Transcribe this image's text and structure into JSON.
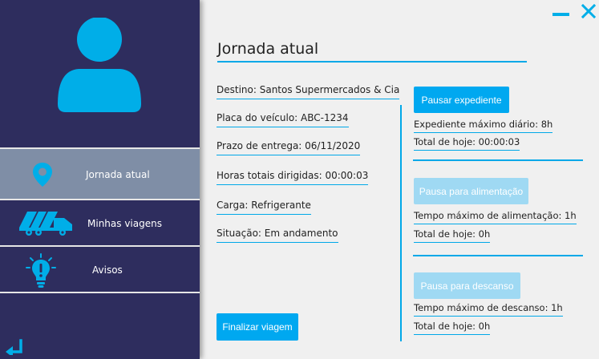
{
  "sidebar": {
    "items": [
      {
        "label": "Jornada atual",
        "icon": "location-pin-icon"
      },
      {
        "label": "Minhas viagens",
        "icon": "truck-icon"
      },
      {
        "label": "Avisos",
        "icon": "lightbulb-alert-icon"
      }
    ]
  },
  "window": {
    "minimize_icon": "minimize-icon",
    "close_icon": "close-icon"
  },
  "main": {
    "title": "Jornada atual",
    "fields": {
      "destino": "Destino: Santos Supermercados & Cia",
      "placa": "Placa do veículo: ABC-1234",
      "prazo": "Prazo de entrega: 06/11/2020",
      "horas": "Horas totais dirigidas: 00:00:03",
      "carga": "Carga: Refrigerante",
      "situacao": "Situação: Em andamento"
    },
    "finalizar_label": "Finalizar viagem",
    "expediente": {
      "button": "Pausar expediente",
      "max": "Expediente máximo diário: 8h",
      "total": "Total de hoje: 00:00:03"
    },
    "alimentacao": {
      "button": "Pausa para alimentação",
      "max": "Tempo máximo de alimentação: 1h",
      "total": "Total de hoje: 0h"
    },
    "descanso": {
      "button": "Pausa para descanso",
      "max": "Tempo máximo de descanso: 1h",
      "total": "Total de hoje: 0h"
    }
  },
  "colors": {
    "sidebar": "#2e2d5e",
    "accent": "#00a8f0",
    "active_item": "#7f8ea6",
    "disabled_button": "#9fd9f3"
  }
}
